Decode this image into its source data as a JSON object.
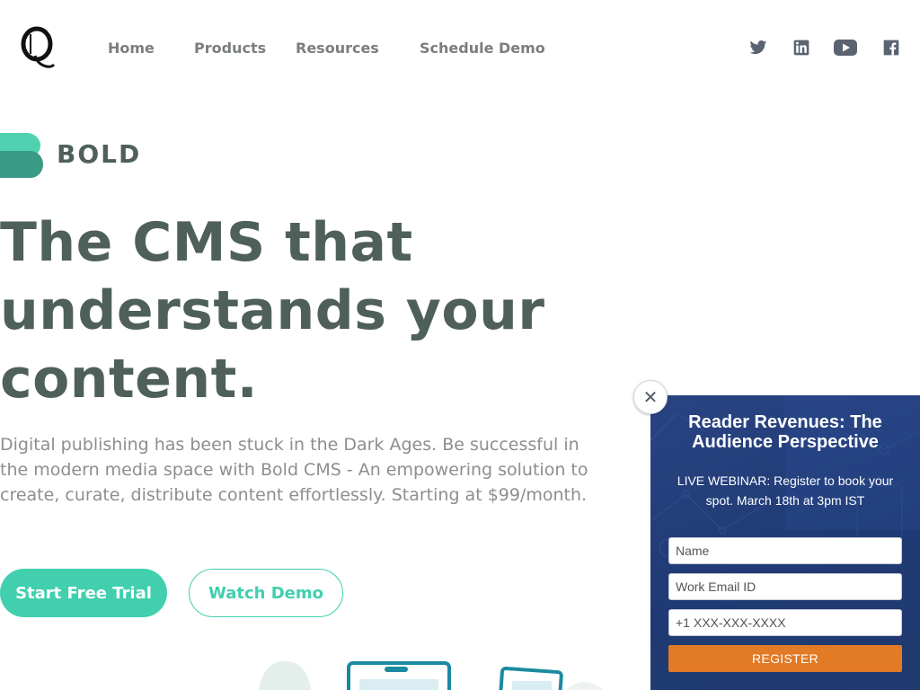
{
  "header": {
    "logo_icon": "quint-q-logo",
    "nav": [
      {
        "label": "Home"
      },
      {
        "label": "Products"
      },
      {
        "label": "Resources"
      },
      {
        "label": "Schedule Demo"
      }
    ],
    "social": [
      "twitter-icon",
      "linkedin-icon",
      "youtube-icon",
      "facebook-icon"
    ]
  },
  "hero": {
    "brand": "BOLD",
    "headline_lines": [
      "The CMS that",
      "understands your",
      "content."
    ],
    "description": "Digital publishing has been stuck in the Dark Ages. Be successful in the modern media space with Bold CMS - An empowering solution to create, curate, distribute content effortlessly. Starting at $99/month.",
    "primary_cta": "Start Free Trial",
    "secondary_cta": "Watch Demo"
  },
  "popup": {
    "close_symbol": "✕",
    "title_lines": [
      "Reader Revenues: The",
      "Audience Perspective"
    ],
    "subtitle": "LIVE WEBINAR: Register to book your spot. March 18th at 3pm IST",
    "name_placeholder": "Name",
    "email_placeholder": "Work Email ID",
    "phone_placeholder": "+1 XXX-XXX-XXXX",
    "register_label": "REGISTER"
  },
  "colors": {
    "accent": "#41cfae",
    "text_dark": "#4f605a",
    "popup_bg": "#1f3a74",
    "register_button": "#e27a26"
  }
}
